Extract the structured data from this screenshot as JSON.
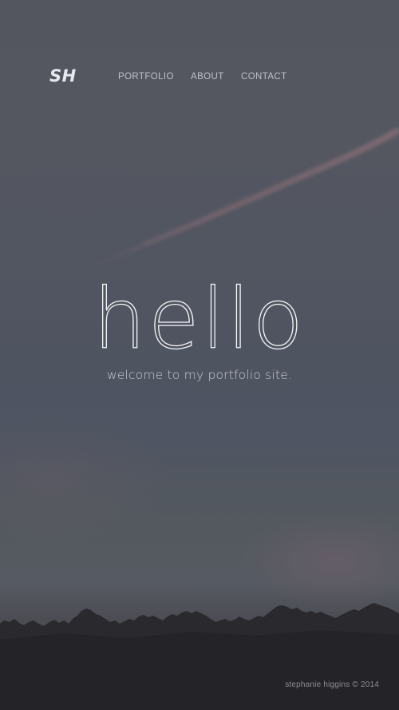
{
  "brand": {
    "logo_text": "SH"
  },
  "nav": {
    "items": [
      {
        "label": "PORTFOLIO"
      },
      {
        "label": "ABOUT"
      },
      {
        "label": "CONTACT"
      }
    ]
  },
  "hero": {
    "headline": "hello",
    "subheadline": "welcome to my portfolio site."
  },
  "footer": {
    "credit": "stephanie higgins © 2014"
  },
  "colors": {
    "sky_top": "#53565f",
    "sky_mid": "#4f5461",
    "treeline": "#29282c",
    "text_primary": "#f5f5f7",
    "nav_text": "#bfc1c9",
    "contrail": "#8a6f78"
  },
  "icons": {
    "moon": "crescent-moon-icon"
  }
}
